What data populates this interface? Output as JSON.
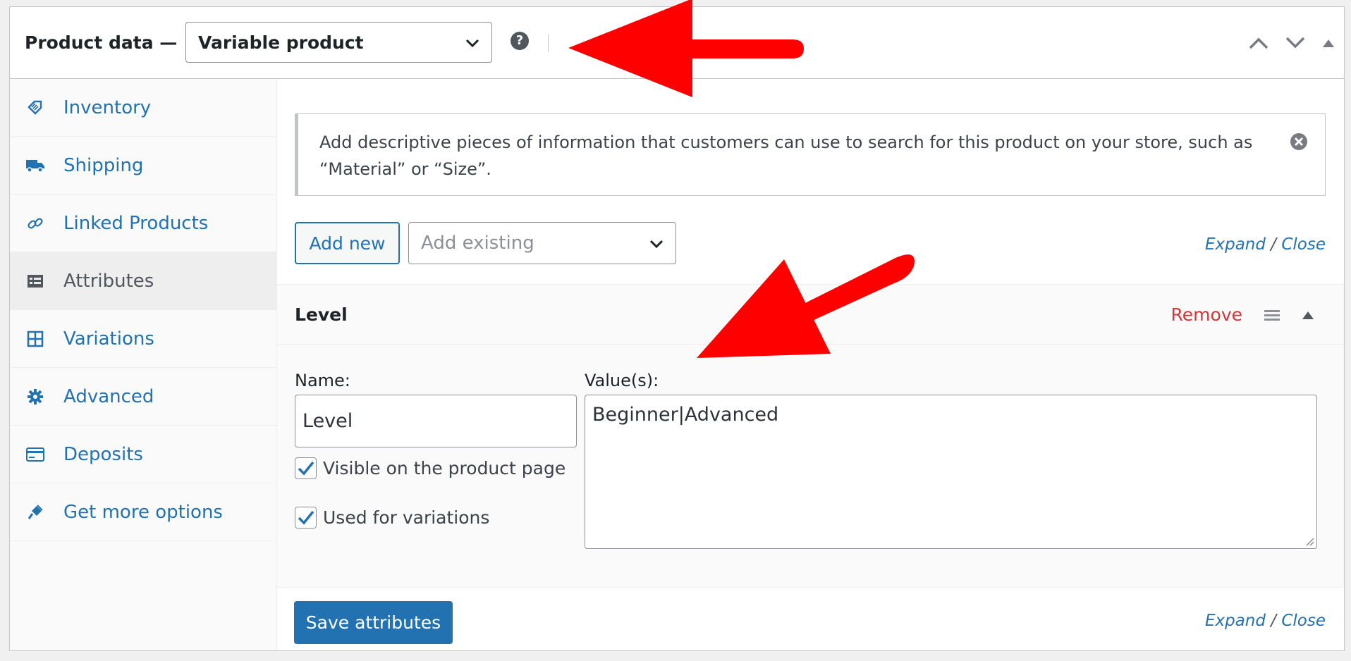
{
  "header": {
    "title": "Product data —",
    "product_type": "Variable product",
    "help_glyph": "?"
  },
  "sidebar": {
    "items": [
      {
        "label": "Inventory",
        "icon": "tag-icon"
      },
      {
        "label": "Shipping",
        "icon": "truck-icon"
      },
      {
        "label": "Linked Products",
        "icon": "link-icon"
      },
      {
        "label": "Attributes",
        "icon": "list-icon",
        "active": true
      },
      {
        "label": "Variations",
        "icon": "grid-icon"
      },
      {
        "label": "Advanced",
        "icon": "gear-icon"
      },
      {
        "label": "Deposits",
        "icon": "card-icon"
      },
      {
        "label": "Get more options",
        "icon": "plugin-icon"
      }
    ]
  },
  "notice": {
    "text": "Add descriptive pieces of information that customers can use to search for this product on your store, such as “Material” or “Size”."
  },
  "toolbar": {
    "add_new": "Add new",
    "add_existing_placeholder": "Add existing",
    "expand": "Expand",
    "slash": "/",
    "close": "Close"
  },
  "attribute": {
    "title": "Level",
    "remove": "Remove",
    "name_label": "Name:",
    "name_value": "Level",
    "values_label": "Value(s):",
    "values_value": "Beginner|Advanced",
    "visible_label": "Visible on the product page",
    "visible_checked": true,
    "variations_label": "Used for variations",
    "variations_checked": true
  },
  "footer": {
    "save": "Save attributes",
    "expand": "Expand",
    "slash": "/",
    "close": "Close"
  },
  "colors": {
    "link": "#2271b1",
    "remove": "#d63638",
    "arrow": "#ff0000"
  }
}
